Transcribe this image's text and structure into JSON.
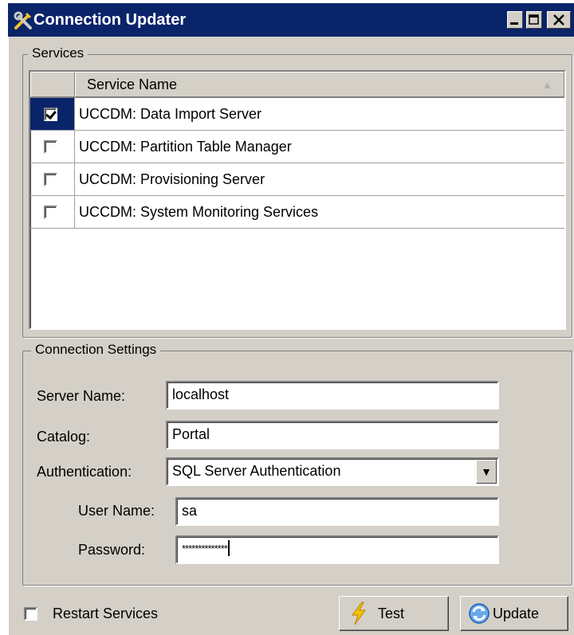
{
  "window": {
    "title": "Connection Updater",
    "controls": [
      "minimize",
      "maximize",
      "close"
    ]
  },
  "services": {
    "legend": "Services",
    "column_header": "Service Name",
    "items": [
      {
        "label": "UCCDM: Data Import Server",
        "checked": true
      },
      {
        "label": "UCCDM: Partition Table Manager",
        "checked": false
      },
      {
        "label": "UCCDM: Provisioning Server",
        "checked": false
      },
      {
        "label": "UCCDM: System Monitoring Services",
        "checked": false
      }
    ]
  },
  "connection": {
    "legend": "Connection Settings",
    "server_name_label": "Server Name:",
    "server_name_value": "localhost",
    "catalog_label": "Catalog:",
    "catalog_value": "Portal",
    "authentication_label": "Authentication:",
    "authentication_value": "SQL Server Authentication",
    "username_label": "User Name:",
    "username_value": "sa",
    "password_label": "Password:",
    "password_value": "**************"
  },
  "footer": {
    "restart_label": "Restart Services",
    "restart_checked": false,
    "test_label": "Test",
    "update_label": "Update"
  },
  "icons": {
    "app": "tools-icon",
    "test": "lightning-icon",
    "update": "refresh-icon"
  }
}
